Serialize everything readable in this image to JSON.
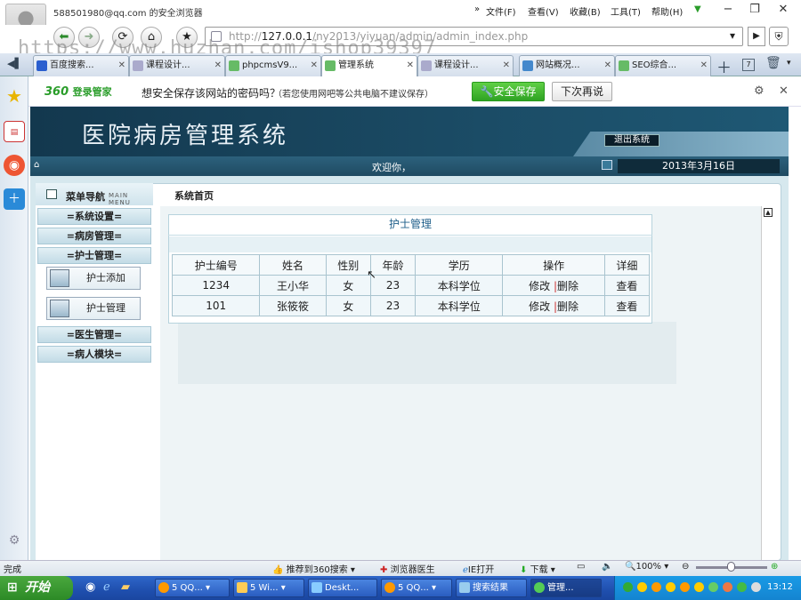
{
  "browser": {
    "window_title": "588501980@qq.com 的安全浏览器",
    "menu": [
      "文件(F)",
      "查看(V)",
      "收藏(B)",
      "工具(T)",
      "帮助(H)"
    ],
    "address_prefix": "http://",
    "address_host": "127.0.0.1",
    "address_path": "/ny2013/yiyuan/admin/admin_index.php",
    "watermark": "https://www.huzhan.com/ishop39397",
    "tabs": [
      {
        "label": "百度搜索...",
        "active": false
      },
      {
        "label": "课程设计...",
        "active": false
      },
      {
        "label": "phpcmsV9...",
        "active": false
      },
      {
        "label": "管理系统",
        "active": true
      },
      {
        "label": "课程设计...",
        "active": false
      },
      {
        "label": "网站概况...",
        "active": false
      },
      {
        "label": "SEO综合...",
        "active": false
      }
    ],
    "pwbar": {
      "logo": "360",
      "logo_suffix": "登录管家",
      "question": "想安全保存该网站的密码吗？",
      "hint": "（若您使用网吧等公共电脑不建议保存）",
      "save_button": "安全保存",
      "later_button": "下次再说"
    },
    "status": {
      "left": "完成",
      "recommend": "推荐到360搜索",
      "doctor": "浏览器医生",
      "ie": "IE打开",
      "download": "下载",
      "zoom": "100%"
    }
  },
  "app": {
    "title": "医院病房管理系统",
    "logout": "退出系统",
    "welcome": "欢迎你，",
    "date": "2013年3月16日",
    "menu_head": "菜单导航",
    "menu_head_sub": "MAIN MENU",
    "breadcrumb": "系统首页",
    "menu": [
      {
        "label": "=系统设置="
      },
      {
        "label": "=病房管理="
      },
      {
        "label": "=护士管理="
      },
      {
        "label": "=医生管理="
      },
      {
        "label": "=病人模块="
      }
    ],
    "submenu": [
      {
        "label": "护士添加"
      },
      {
        "label": "护士管理"
      }
    ],
    "panel_title": "护士管理",
    "table": {
      "headers": [
        "护士编号",
        "姓名",
        "性别",
        "年龄",
        "学历",
        "操作",
        "详细"
      ],
      "rows": [
        {
          "id": "1234",
          "name": "王小华",
          "gender": "女",
          "age": "23",
          "edu": "本科学位",
          "edit": "修改",
          "sep": "|",
          "del": "删除",
          "detail": "查看"
        },
        {
          "id": "101",
          "name": "张筱筱",
          "gender": "女",
          "age": "23",
          "edu": "本科学位",
          "edit": "修改",
          "sep": "|",
          "del": "删除",
          "detail": "查看"
        }
      ]
    }
  },
  "taskbar": {
    "start": "开始",
    "items": [
      {
        "label": "5 QQ...",
        "active": false
      },
      {
        "label": "5 Wi...",
        "active": false
      },
      {
        "label": "Deskt...",
        "active": false
      },
      {
        "label": "5 QQ...",
        "active": false
      },
      {
        "label": "搜索结果",
        "active": false
      },
      {
        "label": "管理...",
        "active": true
      }
    ],
    "clock": "13:12"
  }
}
